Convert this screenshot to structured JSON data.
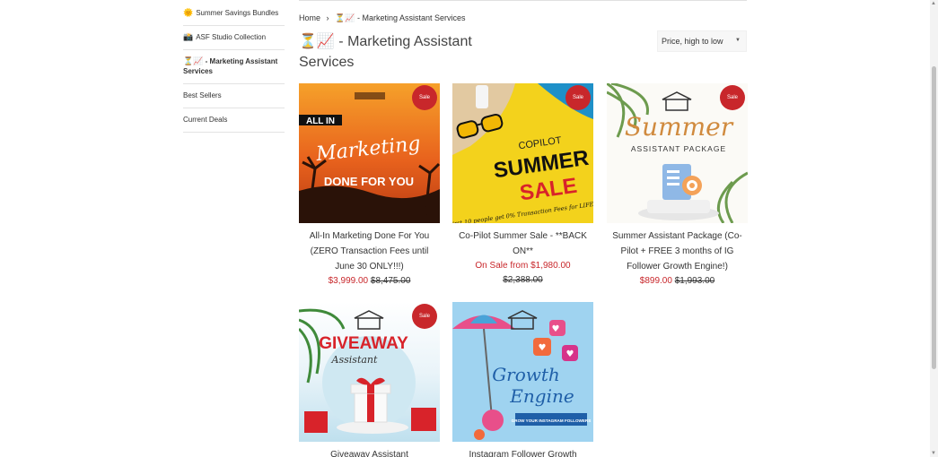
{
  "sidebar": {
    "items": [
      {
        "icon": "🌞",
        "label": "Summer Savings Bundles"
      },
      {
        "icon": "📸",
        "label": "ASF Studio Collection"
      },
      {
        "icon": "⏳📈",
        "label": "- Marketing Assistant Services"
      },
      {
        "icon": "",
        "label": "Best Sellers"
      },
      {
        "icon": "",
        "label": "Current Deals"
      }
    ]
  },
  "breadcrumb": {
    "home": "Home",
    "separator": "›",
    "current": "⏳📈 - Marketing Assistant Services"
  },
  "page": {
    "title": "⏳📈 - Marketing Assistant Services"
  },
  "sort": {
    "selected": "Price, high to low"
  },
  "products": [
    {
      "name": "All-In Marketing Done For You (ZERO Transaction Fees until June 30 ONLY!!!)",
      "badge": "Sale",
      "price": "$3,999.00",
      "compare_price": "$8,475.00",
      "price_prefix": "",
      "image_text": "ALL IN Marketing DONE FOR YOU"
    },
    {
      "name": "Co-Pilot Summer Sale - **BACK ON**",
      "badge": "Sale",
      "price": "On Sale from $1,980.00",
      "compare_price": "$2,388.00",
      "price_prefix": "",
      "image_text": "COPILOT SUMMER SALE"
    },
    {
      "name": "Summer Assistant Package (Co-Pilot + FREE 3 months of IG Follower Growth Engine!)",
      "badge": "Sale",
      "price": "$899.00",
      "compare_price": "$1,993.00",
      "price_prefix": "",
      "image_text": "Summer ASSISTANT PACKAGE"
    },
    {
      "name": "Giveaway Assistant",
      "badge": "Sale",
      "price": "",
      "compare_price": "",
      "price_prefix": "",
      "image_text": "GIVEAWAY Assistant"
    },
    {
      "name": "Instagram Follower Growth",
      "badge": "",
      "price": "",
      "compare_price": "",
      "price_prefix": "",
      "image_text": "Growth Engine"
    }
  ],
  "image_texts": {
    "p1_top": "ALL IN",
    "p1_mid": "Marketing",
    "p1_bot": "DONE FOR YOU",
    "p2_top": "COPILOT",
    "p2_mid": "SUMMER",
    "p2_bot": "SALE",
    "p2_small": "First 10 people get 0% Transaction Fees for LIFE!",
    "p3_top": "Summer",
    "p3_bot": "ASSISTANT PACKAGE",
    "p4_top": "GIVEAWAY",
    "p4_bot": "Assistant",
    "p5_top": "Growth",
    "p5_mid": "Engine",
    "p5_bot": "GROW YOUR INSTAGRAM FOLLOWERS"
  },
  "colors": {
    "sale_red": "#c8272b",
    "orange": "#e8691e",
    "yellow": "#f3d21c",
    "sky": "#9fd3f0"
  }
}
